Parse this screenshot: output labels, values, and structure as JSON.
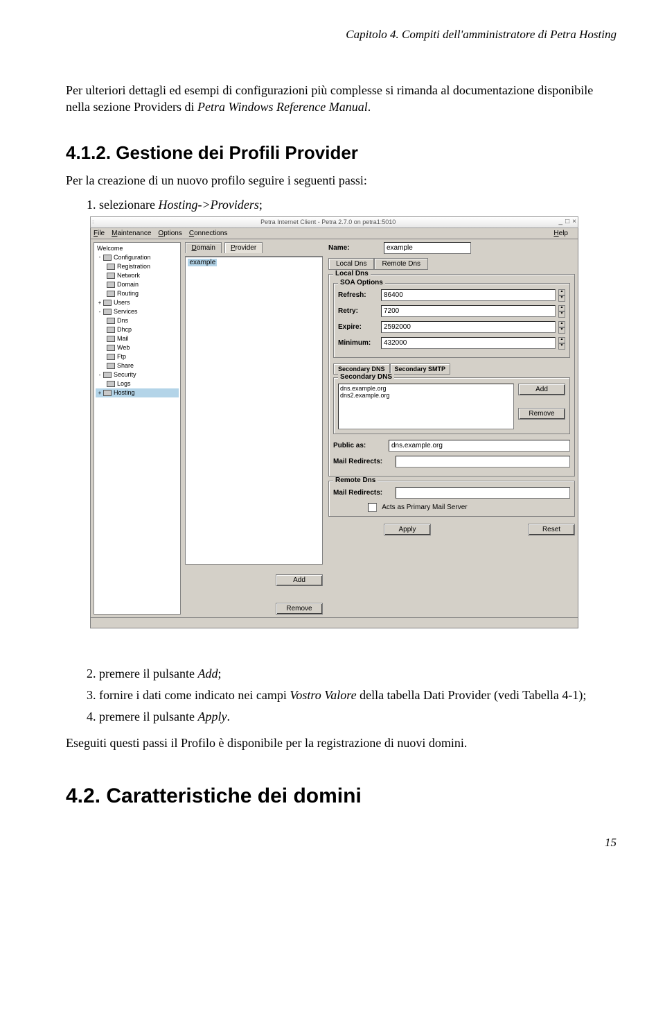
{
  "header": "Capitolo 4. Compiti dell'amministratore di Petra Hosting",
  "para1_a": "Per ulteriori dettagli ed esempi di configurazioni più complesse si rimanda al documentazione disponibile nella sezione Providers di ",
  "para1_b": "Petra Windows Reference Manual",
  "para1_c": ".",
  "h2": "4.1.2. Gestione dei Profili Provider",
  "list_intro": "Per la creazione di un nuovo profilo seguire i seguenti passi:",
  "li1_a": "1. selezionare ",
  "li1_b": "Hosting->Providers",
  "li1_c": ";",
  "li2_a": "2. premere il pulsante ",
  "li2_b": "Add",
  "li2_c": ";",
  "li3_a": "3. fornire i dati come indicato nei campi ",
  "li3_b": "Vostro Valore",
  "li3_c": " della tabella Dati Provider (vedi Tabella 4-1);",
  "li4_a": "4. premere il pulsante ",
  "li4_b": "Apply",
  "li4_c": ".",
  "after": "Eseguiti questi passi il Profilo è disponibile per la registrazione di nuovi domini.",
  "h1": "4.2. Caratteristiche dei domini",
  "pagenum": "15",
  "ss": {
    "title": "Petra Internet Client - Petra 2.7.0 on petra1:5010",
    "menu": {
      "file": "File",
      "maintenance": "Maintenance",
      "options": "Options",
      "connections": "Connections",
      "help": "Help"
    },
    "tree": {
      "welcome": "Welcome",
      "configuration": "Configuration",
      "registration": "Registration",
      "network": "Network",
      "domain": "Domain",
      "routing": "Routing",
      "users": "Users",
      "services": "Services",
      "dns": "Dns",
      "dhcp": "Dhcp",
      "mail": "Mail",
      "web": "Web",
      "ftp": "Ftp",
      "share": "Share",
      "security": "Security",
      "logs": "Logs",
      "hosting": "Hosting"
    },
    "tabs": {
      "domain": "Domain",
      "provider": "Provider"
    },
    "list_item": "example",
    "btns": {
      "add": "Add",
      "remove": "Remove",
      "apply": "Apply",
      "reset": "Reset"
    },
    "right": {
      "name_lbl": "Name:",
      "name_val": "example",
      "localdns_tab": "Local Dns",
      "remotedns_tab": "Remote Dns",
      "localdns_group": "Local Dns",
      "soa_group": "SOA Options",
      "refresh_lbl": "Refresh:",
      "refresh_val": "86400",
      "retry_lbl": "Retry:",
      "retry_val": "7200",
      "expire_lbl": "Expire:",
      "expire_val": "2592000",
      "minimum_lbl": "Minimum:",
      "minimum_val": "432000",
      "secdns_tab": "Secondary DNS",
      "secsmtp_tab": "Secondary SMTP",
      "secdnsbox_title": "Secondary DNS",
      "secdns1": "dns.example.org",
      "secdns2": "dns2.example.org",
      "publicas_lbl": "Public as:",
      "publicas_val": "dns.example.org",
      "mailred_lbl": "Mail Redirects:",
      "remotedns_group": "Remote Dns",
      "acts_primary": "Acts as Primary Mail Server"
    }
  }
}
